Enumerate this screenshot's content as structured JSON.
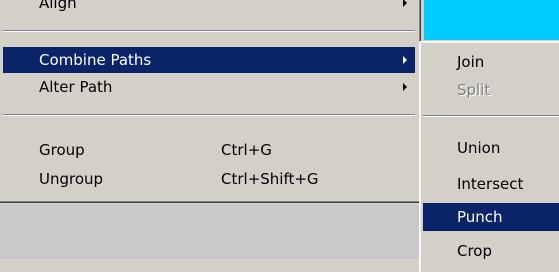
{
  "main_menu": {
    "items": [
      {
        "label": "Align"
      },
      {
        "label": "Combine Paths"
      },
      {
        "label": "Alter Path"
      },
      {
        "label": "Group",
        "shortcut": "Ctrl+G"
      },
      {
        "label": "Ungroup",
        "shortcut": "Ctrl+Shift+G"
      }
    ]
  },
  "submenu": {
    "items": [
      {
        "label": "Join",
        "cut": "("
      },
      {
        "label": "Split",
        "cut": "("
      },
      {
        "label": "Union"
      },
      {
        "label": "Intersect"
      },
      {
        "label": "Punch"
      },
      {
        "label": "Crop"
      }
    ]
  },
  "colors": {
    "highlight": "#0a246a",
    "menu_background": "#d4d0c8",
    "window_accent": "#00ccff"
  }
}
